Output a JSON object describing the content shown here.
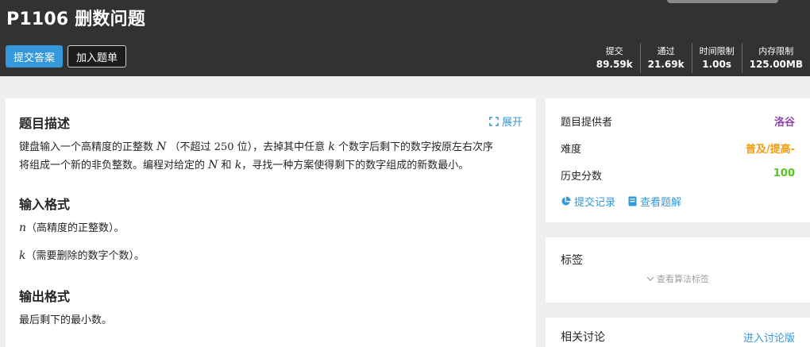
{
  "header": {
    "problem_title": "P1106 删数问题",
    "submit_button": "提交答案",
    "add_to_list_button": "加入题单",
    "stats": [
      {
        "label": "提交",
        "value": "89.59k"
      },
      {
        "label": "通过",
        "value": "21.69k"
      },
      {
        "label": "时间限制",
        "value": "1.00s"
      },
      {
        "label": "内存限制",
        "value": "125.00MB"
      }
    ]
  },
  "problem": {
    "description_heading": "题目描述",
    "expand_label": "展开",
    "desc_line1_a": "键盘输入一个高精度的正整数",
    "var_N": "N",
    "desc_line1_b": "（不超过",
    "num_250": "250",
    "desc_line1_c": "位），去掉其中任意",
    "var_k": "k",
    "desc_line1_d": "个数字后剩下的数字按原左右次序",
    "desc_line2_a": "将组成一个新的非负整数。编程对给定的",
    "desc_line2_b": "和",
    "desc_line2_c": "，寻找一种方案使得剩下的数字组成的新数最小。",
    "input_heading": "输入格式",
    "var_n": "n",
    "input_line1": "（高精度的正整数）。",
    "input_line2": "（需要删除的数字个数）。",
    "output_heading": "输出格式",
    "output_line1": "最后剩下的最小数。"
  },
  "sidebar": {
    "provider_label": "题目提供者",
    "provider_value": "洛谷",
    "difficulty_label": "难度",
    "difficulty_value": "普及/提高-",
    "history_label": "历史分数",
    "history_value": "100",
    "submission_records_link": "提交记录",
    "solutions_link": "查看题解",
    "tags_heading": "标签",
    "show_tags_label": "查看算法标签",
    "discussion_heading": "相关讨论",
    "enter_discussion_link": "进入讨论版"
  },
  "colors": {
    "accent": "#3498db",
    "provider": "#8e44ad",
    "difficulty": "#f39c11",
    "score": "#52c41a"
  }
}
